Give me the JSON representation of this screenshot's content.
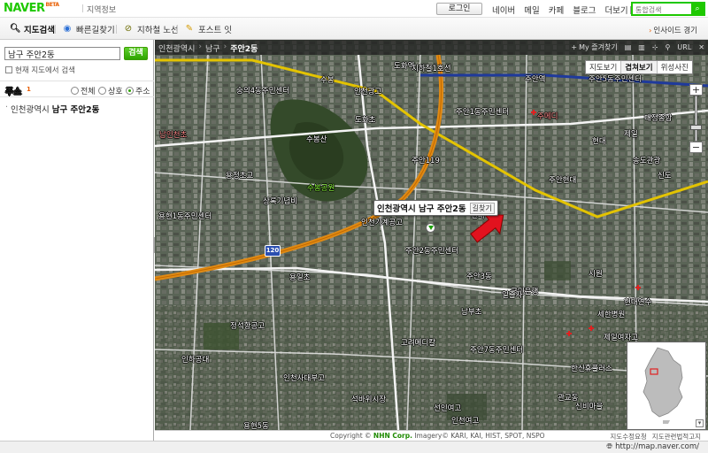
{
  "header": {
    "logo": "NAVER",
    "product": "지도",
    "beta": "BETA",
    "region_link": "지역정보",
    "login": "로그인",
    "nav": [
      "네이버",
      "메일",
      "카페",
      "블로그",
      "더보기"
    ],
    "search_placeholder": "통합검색"
  },
  "tabs": [
    {
      "label": "지도검색",
      "icon": "search-icon",
      "active": true
    },
    {
      "label": "빠른길찾기",
      "icon": "route-icon",
      "active": false
    },
    {
      "label": "지하철 노선",
      "icon": "subway-icon",
      "active": false
    },
    {
      "label": "포스트 잇",
      "icon": "note-icon",
      "active": false
    }
  ],
  "inside_view": "인사이드 경기",
  "search": {
    "query": "남구 주안2동",
    "button": "검색",
    "current_map_only": "현재 지도에서 검색"
  },
  "filter": {
    "title": "주소",
    "count": "1",
    "options": [
      "전체",
      "상호",
      "주소"
    ],
    "selected": "주소"
  },
  "results": [
    {
      "prefix": "인천광역시",
      "name": "남구 주안2동"
    }
  ],
  "map": {
    "breadcrumbs": [
      "인천광역시",
      "남구",
      "주안2동"
    ],
    "tools": [
      "My 즐겨찾기",
      "URL"
    ],
    "view_modes": [
      "지도보기",
      "겹쳐보기",
      "위성사진"
    ],
    "selected_view": "겹쳐보기",
    "highway_number": "120",
    "bubble_name": "인천광역시 남구 주안2동",
    "bubble_route": "길찾기",
    "labels": {
      "l01": "도화역",
      "l02": "지하철1호선",
      "l03": "주안역",
      "l04": "주안5동주민센터",
      "l05": "숭의4동주민센터",
      "l06": "인천광고",
      "l07": "수봉",
      "l08": "주안1동주민센터",
      "l09": "주메디",
      "l10": "대정종합",
      "l11": "도화초",
      "l12": "남인천초",
      "l13": "제일",
      "l14": "수봉산",
      "l15": "현대",
      "l16": "주안119",
      "l17": "송도관광",
      "l18": "용정초교",
      "l19": "수봉공원",
      "l20": "상록기념비",
      "l21": "주안현대",
      "l22": "인천기계공고",
      "l23": "주안2동주민센터",
      "l24": "신도",
      "l25": "연대",
      "l26": "주안3동",
      "l27": "국민은행",
      "l28": "남부초",
      "l29": "세한병원",
      "l30": "제일여자고",
      "l31": "고려메디칼",
      "l32": "주안7동주민센터",
      "l33": "한신휴플러스",
      "l34": "인하공대",
      "l35": "인천사대부고",
      "l36": "석바위시장",
      "l37": "용일초",
      "l38": "관교동",
      "l39": "용현1동주민센터",
      "l40": "정석항공고",
      "l41": "신비마을",
      "l42": "시원",
      "l43": "선인여고",
      "l44": "현대연수",
      "l45": "용현5동",
      "l46": "일출자",
      "l47": "인천여고"
    }
  },
  "footer": {
    "copyright": "Copyright ©",
    "company": "NHN Corp.",
    "imagery": "Imagery© KARI, KAI, HIST, SPOT, NSPO",
    "links": [
      "지도수정요청",
      "지도관련법적고지"
    ]
  },
  "status": {
    "url": "http://map.naver.com/"
  }
}
